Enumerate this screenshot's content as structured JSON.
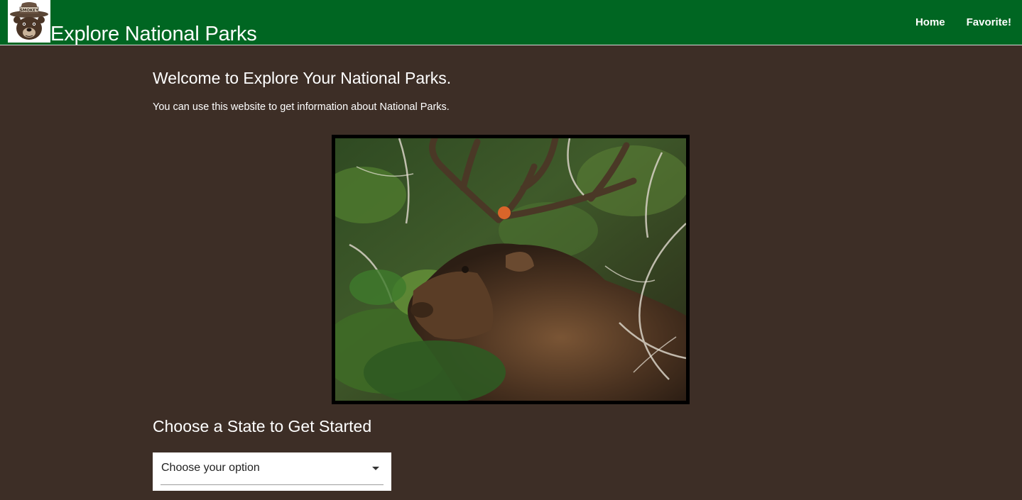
{
  "navbar": {
    "brand": "Explore National Parks",
    "logo_icon": "smokey-bear-logo",
    "logo_text": "SMOKEY",
    "links": [
      {
        "label": "Home"
      },
      {
        "label": "Favorite!"
      }
    ],
    "background_color": "#006622"
  },
  "main": {
    "welcome_title": "Welcome to Explore Your National Parks.",
    "welcome_text": "You can use this website to get information about National Parks.",
    "hero_image_icon": "elk-photo",
    "choose_title": "Choose a State to Get Started",
    "state_select": {
      "selected": "Choose your option"
    }
  },
  "colors": {
    "page_background": "#3d2e26",
    "text": "#ffffff"
  }
}
